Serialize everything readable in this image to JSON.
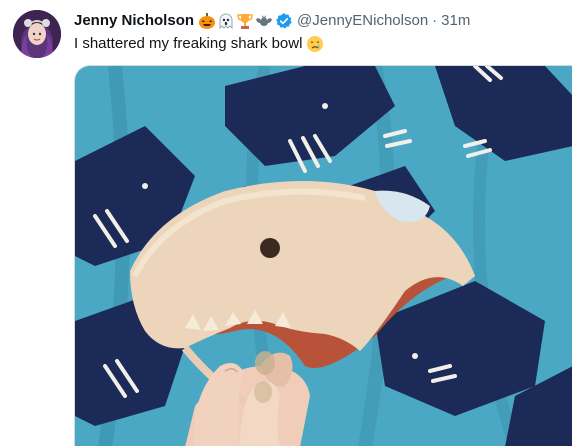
{
  "author": {
    "name": "Jenny Nicholson",
    "handle": "@JennyENicholson",
    "separator": "·",
    "time": "31m",
    "name_emojis": [
      "jack-o-lantern-icon",
      "ghost-icon",
      "trophy-icon",
      "bat-icon"
    ],
    "verified": true
  },
  "tweet": {
    "text": "I shattered my freaking shark bowl",
    "text_emoji": "crying-face-icon"
  },
  "colors": {
    "text_primary": "#0f1419",
    "text_secondary": "#536471",
    "verified_blue": "#1d9bf0",
    "curtain_blue": "#4aa8c4",
    "shark_navy": "#1b2a57"
  }
}
